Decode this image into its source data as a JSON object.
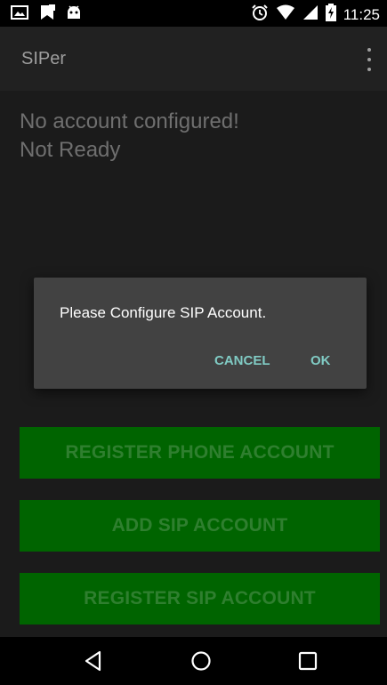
{
  "status_bar": {
    "time": "11:25",
    "left_icons": [
      "image-icon",
      "bookmark-notification-icon",
      "android-icon"
    ],
    "right_icons": [
      "alarm-icon",
      "wifi-icon",
      "signal-icon",
      "battery-charging-icon"
    ]
  },
  "app_bar": {
    "title": "SIPer",
    "menu_icon": "overflow-menu-icon"
  },
  "main": {
    "status_line_1": "No account configured!",
    "status_line_2": "Not Ready",
    "buttons": [
      {
        "label": "REGISTER PHONE ACCOUNT"
      },
      {
        "label": "ADD SIP ACCOUNT"
      },
      {
        "label": "REGISTER SIP ACCOUNT"
      }
    ]
  },
  "dialog": {
    "message": "Please Configure SIP Account.",
    "cancel_label": "CANCEL",
    "ok_label": "OK"
  },
  "nav_bar": {
    "icons": [
      "back-icon",
      "home-icon",
      "recents-icon"
    ]
  },
  "colors": {
    "background": "#1b1b1b",
    "app_bar": "#212121",
    "button_green": "#006400",
    "dialog_bg": "#424242",
    "dialog_accent": "#80cbc4"
  }
}
